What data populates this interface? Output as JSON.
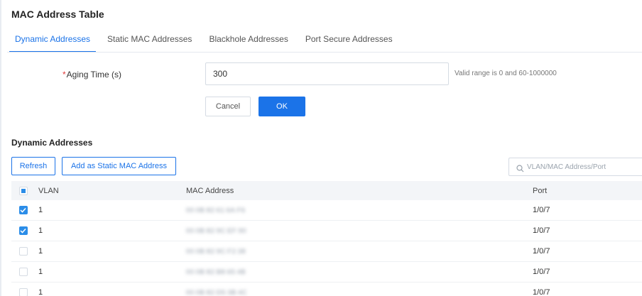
{
  "page": {
    "title": "MAC Address Table"
  },
  "tabs": [
    {
      "label": "Dynamic Addresses",
      "active": true
    },
    {
      "label": "Static MAC Addresses",
      "active": false
    },
    {
      "label": "Blackhole Addresses",
      "active": false
    },
    {
      "label": "Port Secure Addresses",
      "active": false
    }
  ],
  "aging_form": {
    "required_mark": "*",
    "label": "Aging Time (s)",
    "value": "300",
    "hint": "Valid range is 0 and 60-1000000",
    "cancel_label": "Cancel",
    "ok_label": "OK"
  },
  "dynamic_section": {
    "title": "Dynamic Addresses",
    "refresh_label": "Refresh",
    "add_static_label": "Add as Static MAC Address",
    "search_placeholder": "VLAN/MAC Address/Port",
    "search_icon": "search-icon"
  },
  "table": {
    "columns": {
      "vlan": "VLAN",
      "mac": "MAC Address",
      "port": "Port"
    },
    "select_all_state": "indeterminate",
    "rows": [
      {
        "checked": true,
        "vlan": "1",
        "mac": "00:0B:82:61:6A:F6",
        "port": "1/0/7"
      },
      {
        "checked": true,
        "vlan": "1",
        "mac": "00:0B:82:9C:EF:90",
        "port": "1/0/7"
      },
      {
        "checked": false,
        "vlan": "1",
        "mac": "00:0B:82:9C:F2:38",
        "port": "1/0/7"
      },
      {
        "checked": false,
        "vlan": "1",
        "mac": "00:0B:82:B8:65:4B",
        "port": "1/0/7"
      },
      {
        "checked": false,
        "vlan": "1",
        "mac": "00:0B:82:D5:3B:4C",
        "port": "1/0/7"
      }
    ]
  },
  "colors": {
    "accent": "#1b73e8",
    "checkbox_checked": "#2b8de8",
    "required": "#e03b3b",
    "header_bg": "#f3f5f8"
  }
}
